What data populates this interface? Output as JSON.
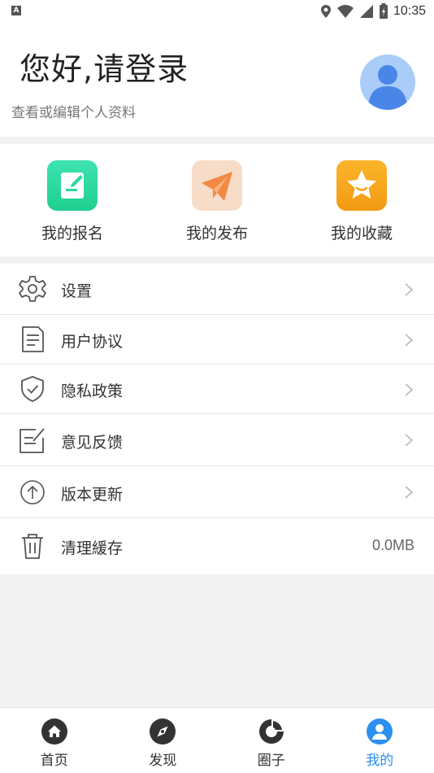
{
  "status_bar": {
    "time": "10:35",
    "left_badge": "A",
    "icons": [
      "location-icon",
      "wifi-icon",
      "signal-icon",
      "battery-icon"
    ]
  },
  "header": {
    "greeting": "您好,请登录",
    "subtitle": "查看或编辑个人资料",
    "avatar_color": "#a9cdf8",
    "avatar_figure_color": "#4a86e8"
  },
  "quick_actions": [
    {
      "label": "我的报名",
      "icon": "edit-icon",
      "color": "#2fd8a0"
    },
    {
      "label": "我的发布",
      "icon": "paper-plane-icon",
      "color": "#f7dcc8"
    },
    {
      "label": "我的收藏",
      "icon": "star-icon",
      "color": "#f7a21b"
    }
  ],
  "menu": [
    {
      "label": "设置",
      "icon": "gear-icon",
      "chevron": true
    },
    {
      "label": "用户协议",
      "icon": "document-icon",
      "chevron": true
    },
    {
      "label": "隐私政策",
      "icon": "shield-icon",
      "chevron": true
    },
    {
      "label": "意见反馈",
      "icon": "feedback-icon",
      "chevron": true
    },
    {
      "label": "版本更新",
      "icon": "upload-icon",
      "chevron": true
    },
    {
      "label": "清理緩存",
      "icon": "trash-icon",
      "value": "0.0MB"
    }
  ],
  "tabbar": {
    "active_color": "#2b8ff0",
    "tabs": [
      {
        "label": "首页",
        "icon": "home-icon",
        "active": false
      },
      {
        "label": "发现",
        "icon": "compass-icon",
        "active": false
      },
      {
        "label": "圈子",
        "icon": "circle-icon",
        "active": false
      },
      {
        "label": "我的",
        "icon": "user-icon",
        "active": true
      }
    ]
  }
}
